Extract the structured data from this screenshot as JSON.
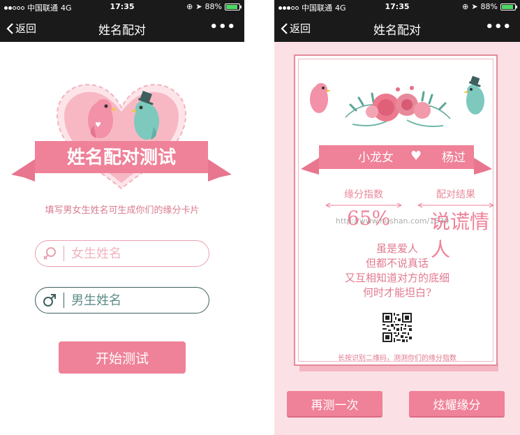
{
  "status_bar": {
    "carrier": "中国联通",
    "network": "4G",
    "time": "17:35",
    "battery": "88%",
    "battery_fraction": 0.88
  },
  "nav": {
    "back_label": "返回",
    "title": "姓名配对",
    "more_label": "•••"
  },
  "left_screen": {
    "banner_title": "姓名配对测试",
    "subtitle": "填写男女生姓名可生成你们的缘分卡片",
    "female_placeholder": "女生姓名",
    "male_placeholder": "男生姓名",
    "start_button": "开始测试",
    "female_symbol": "♀",
    "male_symbol": "♂"
  },
  "right_screen": {
    "female_name": "小龙女",
    "male_name": "杨过",
    "heart_symbol": "♥",
    "fate_label": "缘分指数",
    "result_label": "配对结果",
    "fate_value": "65%",
    "result_value": "说谎情人",
    "watermark": "http://www.hushan.com/1530",
    "poem": [
      "虽是爱人",
      "但都不说真话",
      "又互相知道对方的底细",
      "何时才能坦白?"
    ],
    "footer": "长按识别二维码，测测你们的缘分指数",
    "retry_button": "再测一次",
    "share_button": "炫耀缘分"
  },
  "colors": {
    "accent_pink": "#ef8198",
    "light_pink": "#fbe1e5",
    "dark_teal": "#3e5f5d",
    "nav_bg": "#1a1a1a"
  },
  "icons": [
    "back-chevron-icon",
    "location-arrow-icon",
    "lock-rotation-icon",
    "female-icon",
    "male-icon",
    "bird-icon",
    "flower-icon",
    "qr-code-icon",
    "heart-icon"
  ]
}
